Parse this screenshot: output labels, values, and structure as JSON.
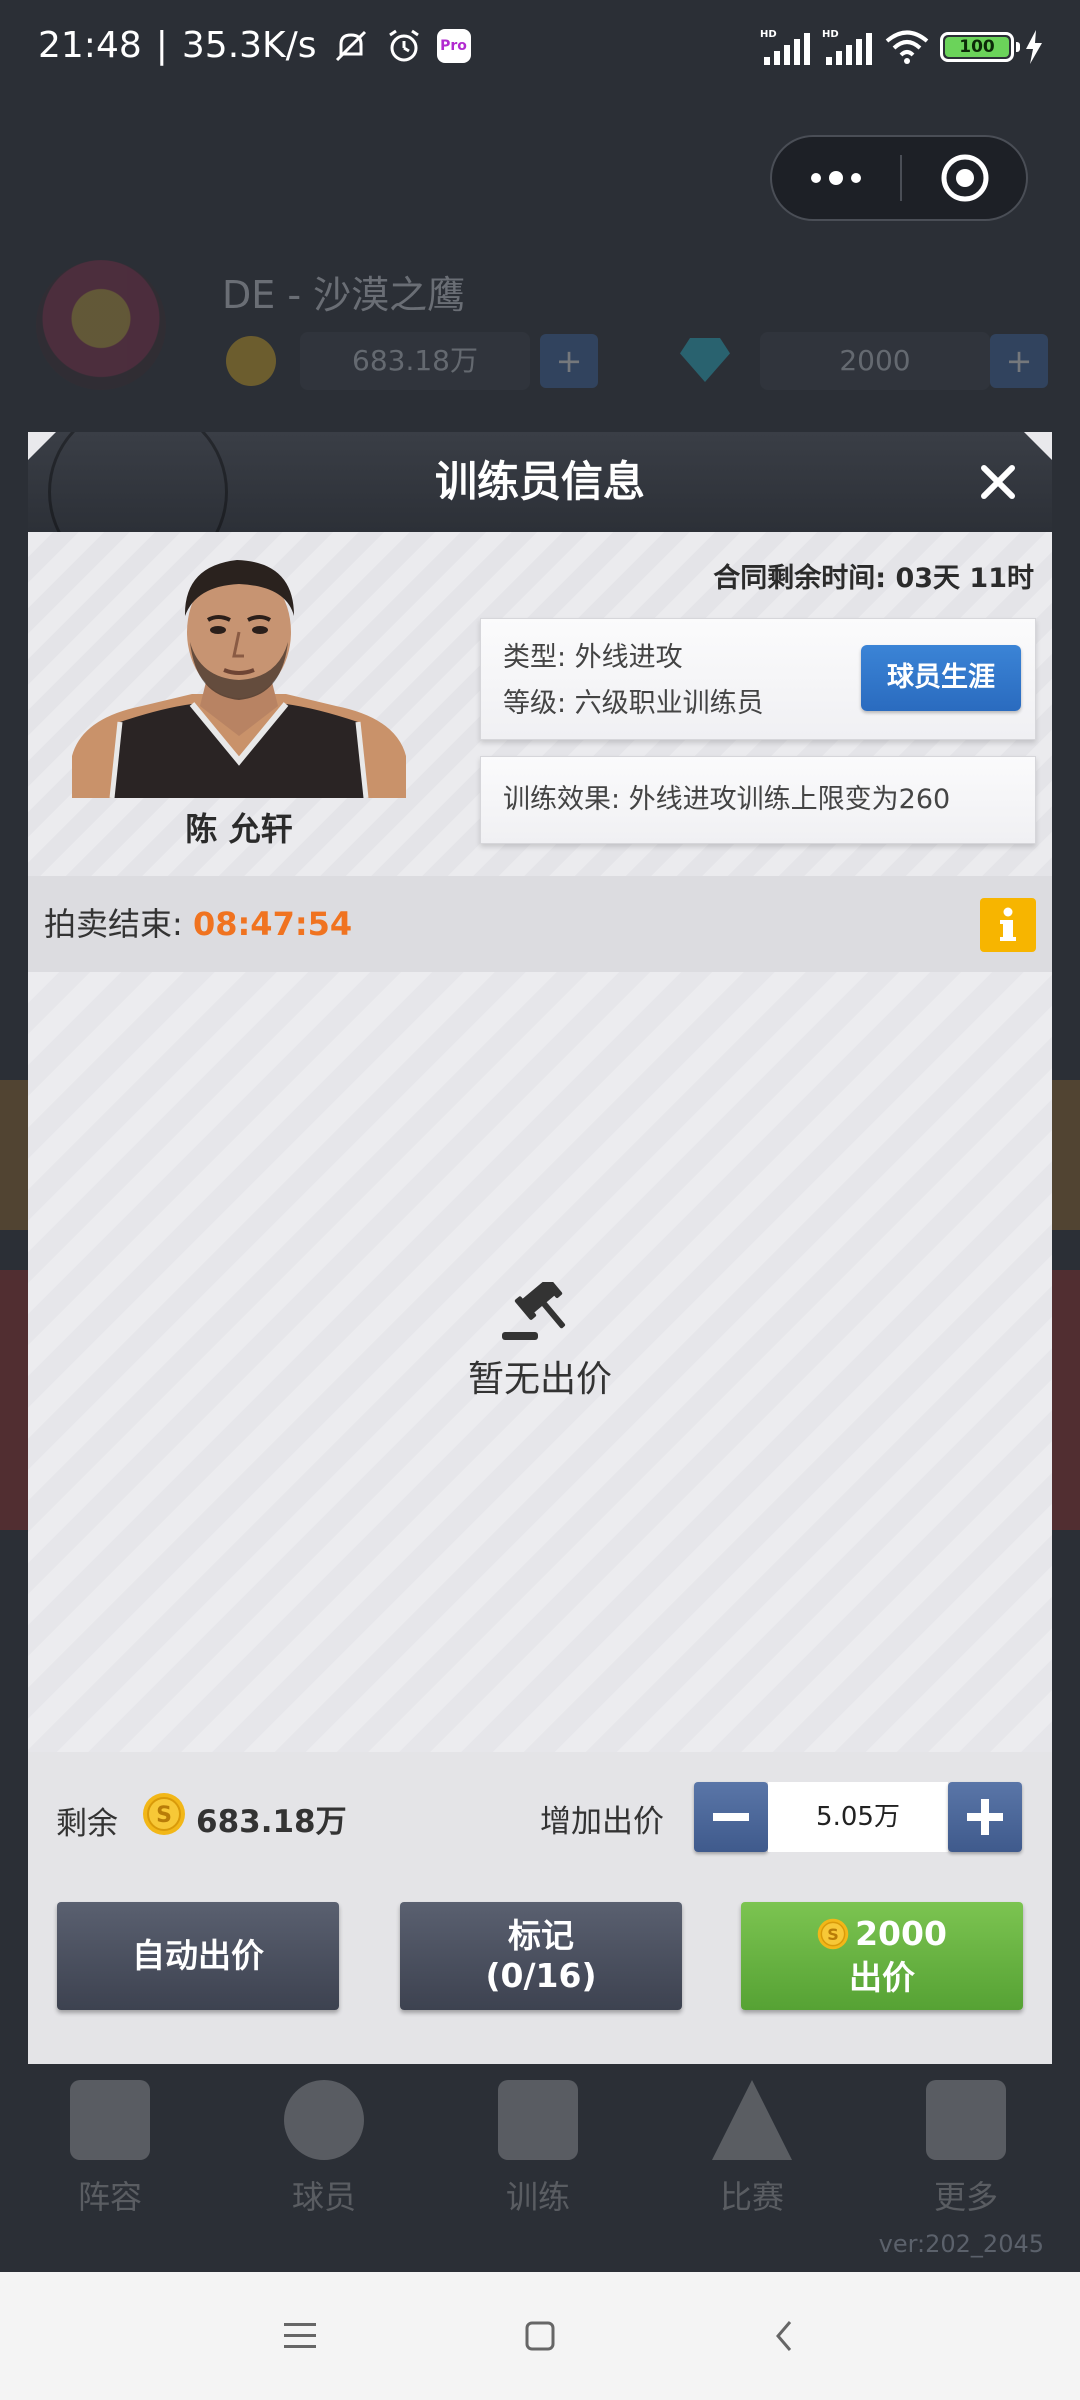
{
  "status_bar": {
    "time": "21:48",
    "separator": "|",
    "net_speed": "35.3K/s",
    "battery": "100",
    "pro_badge": "Pro"
  },
  "background_app": {
    "club_name": "DE - 沙漠之鹰",
    "coins": "683.18万",
    "gems": "2000",
    "plus": "+",
    "nav_items": [
      "阵容",
      "球员",
      "训练",
      "比赛",
      "更多"
    ],
    "version": "ver:202_2045"
  },
  "modal": {
    "title": "训练员信息",
    "trainer": {
      "name": "陈 允轩",
      "contract_label": "合同剩余时间:",
      "contract_time": "03天 11时",
      "type_line": "类型: 外线进攻",
      "level_line": "等级: 六级职业训练员",
      "career_button": "球员生涯",
      "effect_line": "训练效果: 外线进攻训练上限变为260"
    },
    "auction": {
      "end_label": "拍卖结束:",
      "end_time": "08:47:54"
    },
    "bids": {
      "empty_text": "暂无出价"
    },
    "bottom": {
      "remain_label": "剩余",
      "remain_value": "683.18万",
      "increase_label": "增加出价",
      "increment_value": "5.05万",
      "auto_bid_button": "自动出价",
      "mark_button_line1": "标记",
      "mark_button_line2": "(0/16)",
      "bid_price": "2000",
      "bid_button_label": "出价"
    }
  },
  "colors": {
    "accent_blue": "#2a6bbf",
    "timer_orange": "#f07320",
    "info_yellow": "#f7b500",
    "bid_green": "#6bb543",
    "header_dark": "#2f333a"
  },
  "icons": {
    "close": "close-icon",
    "info": "info-icon",
    "gavel": "gavel-icon",
    "coin": "coin-icon",
    "minus": "minus-icon",
    "plus": "plus-icon"
  }
}
